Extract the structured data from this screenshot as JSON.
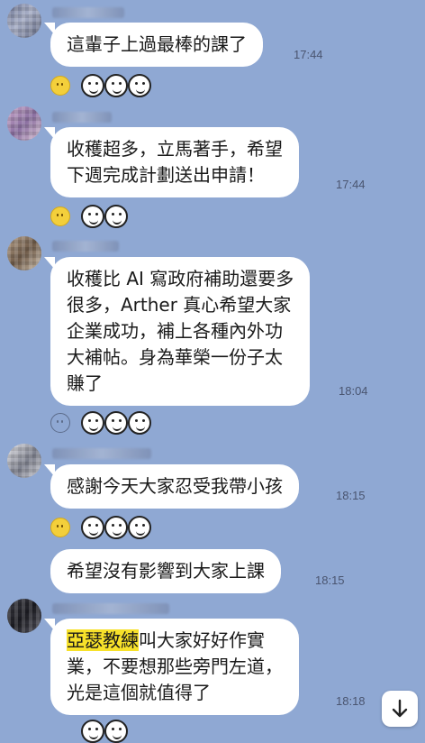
{
  "messages": [
    {
      "text": "這輩子上過最棒的課了",
      "time": "17:44"
    },
    {
      "text": "收穫超多，立馬著手，希望\n下週完成計劃送出申請！",
      "time": "17:44"
    },
    {
      "text": "收穫比 AI 寫政府補助還要多\n很多，Arther 真心希望大家\n企業成功，補上各種內外功\n大補帖。身為華榮一份子太\n賺了",
      "time": "18:04"
    },
    {
      "text": "感謝今天大家忍受我帶小孩",
      "time": "18:15"
    },
    {
      "text": "希望沒有影響到大家上課",
      "time": "18:15"
    },
    {
      "highlight": "亞瑟教練",
      "text_after": "叫大家好好作實\n業，不要想那些旁門左道，\n光是這個就值得了",
      "time": "18:18"
    }
  ],
  "icons": {
    "reaction": "smile-reaction-icon",
    "sticker": "laughing-face-sticker-icon",
    "scroll": "arrow-down-icon"
  },
  "colors": {
    "background": "#8fa8d3",
    "bubble": "#ffffff",
    "highlight": "#f7e12a"
  }
}
